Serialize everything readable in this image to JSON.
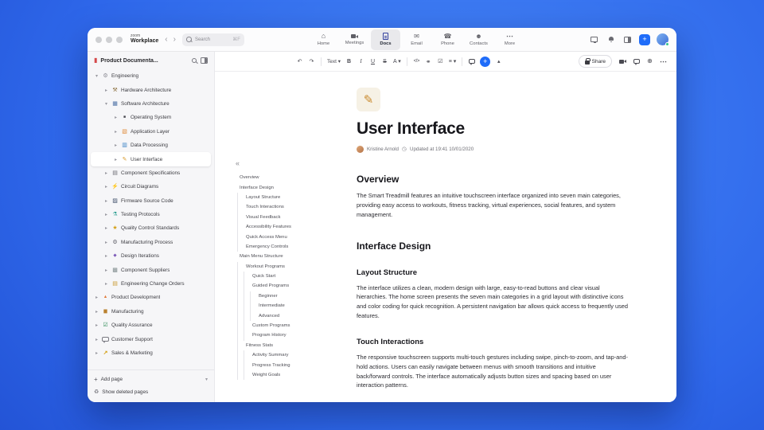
{
  "glyphs": {
    "expanded": "▾",
    "collapsed": "▸"
  },
  "titlebar": {
    "brand_top": "zoom",
    "brand_bottom": "Workplace",
    "back_glyph": "‹",
    "forward_glyph": "›",
    "search": {
      "placeholder": "Search",
      "shortcut": "⌘F"
    },
    "tabs": [
      {
        "name": "tab-home",
        "label": "Home",
        "icon": "home"
      },
      {
        "name": "tab-meetings",
        "label": "Meetings",
        "icon": "camera"
      },
      {
        "name": "tab-docs",
        "label": "Docs",
        "icon": "doc",
        "active": true
      },
      {
        "name": "tab-email",
        "label": "Email",
        "icon": "email"
      },
      {
        "name": "tab-phone",
        "label": "Phone",
        "icon": "phone"
      },
      {
        "name": "tab-contacts",
        "label": "Contacts",
        "icon": "contacts"
      },
      {
        "name": "tab-more",
        "label": "More",
        "icon": "more"
      }
    ],
    "right_icons": [
      {
        "name": "devices-button",
        "icon": "monitor"
      },
      {
        "name": "notifications-button",
        "icon": "bell"
      },
      {
        "name": "panel-toggle-button",
        "icon": "panel"
      }
    ],
    "plus_label": "+"
  },
  "sidebar": {
    "icon": "notebook-red",
    "title": "Product Documenta...",
    "plus_glyph": "+",
    "collapse_glyph": "▾",
    "add_page": "Add page",
    "show_deleted": "Show deleted pages",
    "tree": [
      {
        "label": "Engineering",
        "depth": 0,
        "expanded": true,
        "icon": "gear",
        "icon_color": "#8a8a92"
      },
      {
        "label": "Hardware Architecture",
        "depth": 1,
        "expanded": false,
        "icon": "hammer",
        "icon_color": "#8a6d3b"
      },
      {
        "label": "Software Architecture",
        "depth": 1,
        "expanded": true,
        "icon": "grid",
        "icon_color": "#4a6fa5"
      },
      {
        "label": "Operating System",
        "depth": 2,
        "expanded": false,
        "icon": "square",
        "icon_color": "#44444c"
      },
      {
        "label": "Application Layer",
        "depth": 2,
        "expanded": false,
        "icon": "layers",
        "icon_color": "#e08b3a"
      },
      {
        "label": "Data Processing",
        "depth": 2,
        "expanded": false,
        "icon": "rows",
        "icon_color": "#3b82c4"
      },
      {
        "label": "User Interface",
        "depth": 2,
        "expanded": false,
        "icon": "pencil",
        "icon_color": "#d99a2b",
        "selected": true
      },
      {
        "label": "Component Specifications",
        "depth": 1,
        "expanded": false,
        "icon": "doclines",
        "icon_color": "#6b6b72"
      },
      {
        "label": "Circuit Diagrams",
        "depth": 1,
        "expanded": false,
        "icon": "bolt",
        "icon_color": "#2f9e5f"
      },
      {
        "label": "Firmware Source Code",
        "depth": 1,
        "expanded": false,
        "icon": "chip",
        "icon_color": "#3a4a66"
      },
      {
        "label": "Testing Protocols",
        "depth": 1,
        "expanded": false,
        "icon": "flask",
        "icon_color": "#2a9d8f"
      },
      {
        "label": "Quality Control Standards",
        "depth": 1,
        "expanded": false,
        "icon": "star",
        "icon_color": "#d4a017"
      },
      {
        "label": "Manufacturing Process",
        "depth": 1,
        "expanded": false,
        "icon": "gear",
        "icon_color": "#64646c"
      },
      {
        "label": "Design Iterations",
        "depth": 1,
        "expanded": false,
        "icon": "diamond",
        "icon_color": "#7d5bb8"
      },
      {
        "label": "Component Suppliers",
        "depth": 1,
        "expanded": false,
        "icon": "box",
        "icon_color": "#7f8c8d"
      },
      {
        "label": "Engineering Change Orders",
        "depth": 1,
        "expanded": false,
        "icon": "doclines",
        "icon_color": "#c99a2e"
      },
      {
        "label": "Product Development",
        "depth": 0,
        "expanded": false,
        "icon": "rocket",
        "icon_color": "#e07a3a"
      },
      {
        "label": "Manufacturing",
        "depth": 0,
        "expanded": false,
        "icon": "building",
        "icon_color": "#b9812f"
      },
      {
        "label": "Quality Assurance",
        "depth": 0,
        "expanded": false,
        "icon": "check",
        "icon_color": "#2e8b57"
      },
      {
        "label": "Customer Support",
        "depth": 0,
        "expanded": false,
        "icon": "chat",
        "icon_color": "#7a7a82"
      },
      {
        "label": "Sales & Marketing",
        "depth": 0,
        "expanded": false,
        "icon": "trend",
        "icon_color": "#d4a017"
      }
    ]
  },
  "toolbar": {
    "items": [
      {
        "name": "undo-button",
        "glyph": "↶"
      },
      {
        "name": "redo-button",
        "glyph": "↷"
      },
      {
        "name": "divider"
      },
      {
        "name": "text-style-dropdown",
        "glyph": "Text ▾"
      },
      {
        "name": "bold-button",
        "glyph": "B"
      },
      {
        "name": "italic-button",
        "glyph": "I"
      },
      {
        "name": "underline-button",
        "glyph": "U"
      },
      {
        "name": "strikethrough-button",
        "glyph": "S"
      },
      {
        "name": "text-color-button",
        "glyph": "A ▾"
      },
      {
        "name": "divider"
      },
      {
        "name": "code-button",
        "glyph": "</>"
      },
      {
        "name": "link-button",
        "icon": "link-rings"
      },
      {
        "name": "checklist-button",
        "glyph": "☑"
      },
      {
        "name": "align-button",
        "glyph": "≡ ▾"
      },
      {
        "name": "divider"
      },
      {
        "name": "comment-button",
        "icon": "chat"
      },
      {
        "name": "insert-button",
        "glyph": "+"
      },
      {
        "name": "collapse-toolbar-button",
        "glyph": "▴"
      }
    ],
    "avatars": [
      {
        "color": "#e09a66"
      },
      {
        "color": "#8c6fd9"
      },
      {
        "color": "#5f9dd9"
      }
    ],
    "share_label": "Share",
    "right_icons": [
      {
        "name": "video-button",
        "icon": "camera"
      },
      {
        "name": "chat-button",
        "icon": "chat"
      },
      {
        "name": "globe-button",
        "icon": "globe"
      },
      {
        "name": "more-options-button",
        "icon": "more"
      }
    ]
  },
  "outline": {
    "collapse_glyph": "«",
    "items": [
      {
        "label": "Overview",
        "depth": 0
      },
      {
        "label": "Interface Design",
        "depth": 0
      },
      {
        "label": "Layout Structure",
        "depth": 1
      },
      {
        "label": "Touch Interactions",
        "depth": 1
      },
      {
        "label": "Visual Feedback",
        "depth": 1
      },
      {
        "label": "Accessibility Features",
        "depth": 1
      },
      {
        "label": "Quick Access Menu",
        "depth": 1
      },
      {
        "label": "Emergency Controls",
        "depth": 1
      },
      {
        "label": "Main Menu Structure",
        "depth": 0
      },
      {
        "label": "Workout Programs",
        "depth": 1
      },
      {
        "label": "Quick Start",
        "depth": 2
      },
      {
        "label": "Guided Programs",
        "depth": 2
      },
      {
        "label": "Beginner",
        "depth": 3
      },
      {
        "label": "Intermediate",
        "depth": 3
      },
      {
        "label": "Advanced",
        "depth": 3
      },
      {
        "label": "Custom Programs",
        "depth": 2
      },
      {
        "label": "Program History",
        "depth": 2
      },
      {
        "label": "Fitness Stats",
        "depth": 1
      },
      {
        "label": "Activity Summary",
        "depth": 2
      },
      {
        "label": "Progress Tracking",
        "depth": 2
      },
      {
        "label": "Weight Goals",
        "depth": 2
      }
    ]
  },
  "document": {
    "icon": "pencil",
    "title": "User Interface",
    "author": "Kristine Arnold",
    "updated": "Updated at 19:41 10/01/2020",
    "overview": {
      "heading": "Overview",
      "text": "The Smart Treadmill features an intuitive touchscreen interface organized into seven main categories, providing easy access to workouts, fitness tracking, virtual experiences, social features, and system management."
    },
    "interface_design": {
      "heading": "Interface Design"
    },
    "layout_structure": {
      "heading": "Layout Structure",
      "text": "The interface utilizes a clean, modern design with large, easy-to-read buttons and clear visual hierarchies. The home screen presents the seven main categories in a grid layout with distinctive icons and color coding for quick recognition. A persistent navigation bar allows quick access to frequently used features."
    },
    "touch_interactions": {
      "heading": "Touch Interactions",
      "text": "The responsive touchscreen supports multi-touch gestures including swipe, pinch-to-zoom, and tap-and-hold actions. Users can easily navigate between menus with smooth transitions and intuitive back/forward controls. The interface automatically adjusts button sizes and spacing based on user interaction patterns."
    }
  }
}
